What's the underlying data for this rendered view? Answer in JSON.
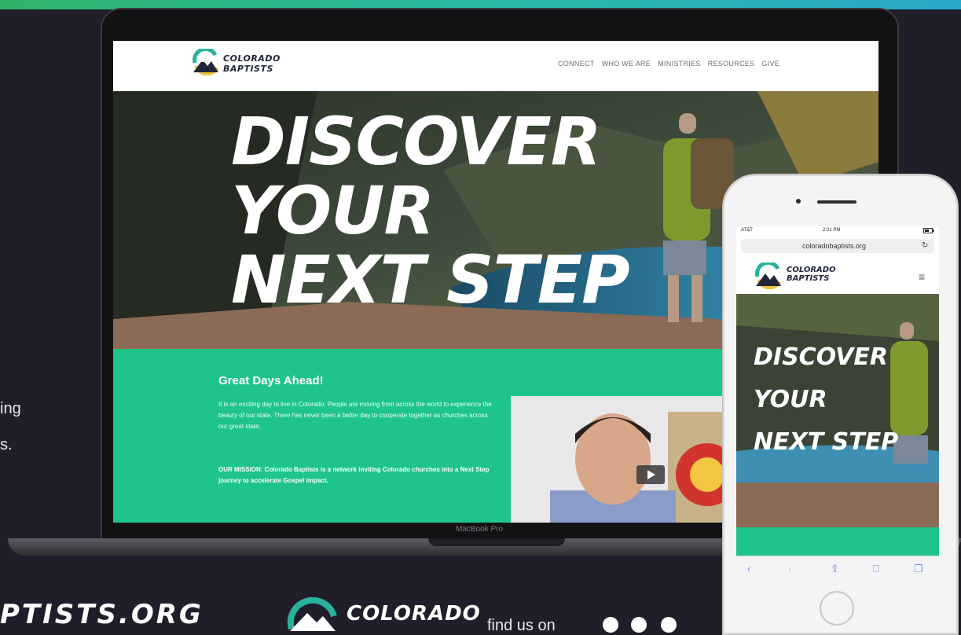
{
  "left_text": {
    "line1": "ing",
    "line2": "s."
  },
  "footer": {
    "url_fragment": "PTISTS.ORG",
    "logo_word": "COLORADO",
    "find_us_label": "find us on",
    "social_icons": [
      "youtube-icon",
      "instagram-icon",
      "facebook-icon"
    ]
  },
  "laptop": {
    "model_label": "MacBook Pro",
    "site": {
      "logo_line1": "COLORADO",
      "logo_line2": "BAPTISTS",
      "nav": [
        "CONNECT",
        "WHO WE ARE",
        "MINISTRIES",
        "RESOURCES",
        "GIVE"
      ],
      "hero_line1": "DISCOVER",
      "hero_line2": "YOUR",
      "hero_line3": "NEXT STEP",
      "section_title": "Great Days Ahead!",
      "section_body": "It is an exciting day to live in Colorado. People are moving from across the world to experience the beauty of our state. There has never been a better day to cooperate together as churches across our great state.",
      "mission": "OUR MISSION:  Colorado Baptists is a network inviting Colorado churches into a Next Step journey to accelerate Gospel impact."
    }
  },
  "phone": {
    "carrier": "AT&T",
    "time": "2:21 PM",
    "url": "coloradobaptists.org",
    "logo_line1": "COLORADO",
    "logo_line2": "BAPTISTS",
    "hero_line1": "DISCOVER",
    "hero_line2": "YOUR",
    "hero_line3": "NEXT STEP"
  },
  "colors": {
    "background": "#1f1e2a",
    "brand_green": "#1ec48a",
    "brand_teal": "#29b9a8"
  }
}
